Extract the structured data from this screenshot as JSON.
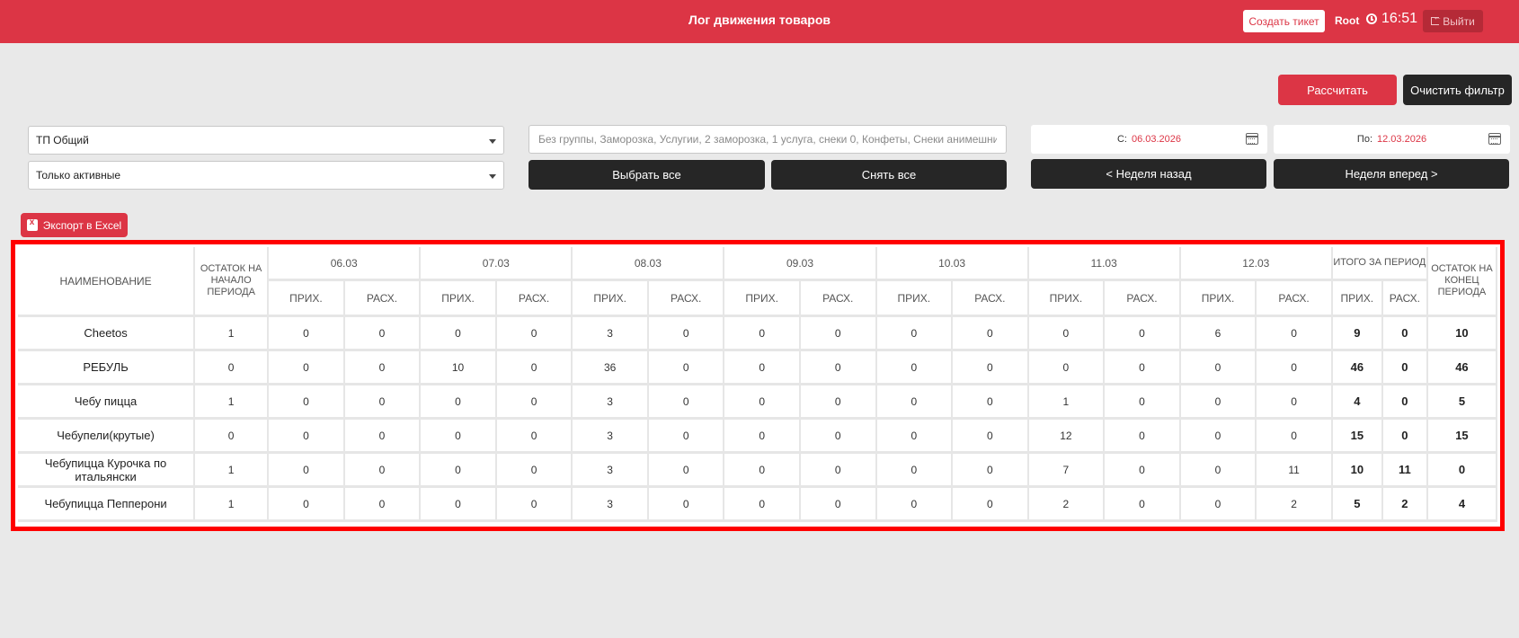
{
  "header": {
    "title": "Лог движения товаров",
    "create_ticket": "Создать тикет",
    "user": "Root",
    "time": "16:51",
    "logout": "Выйти"
  },
  "actions": {
    "calculate": "Рассчитать",
    "clear_filter": "Очистить фильтр"
  },
  "filters": {
    "point": "ТП Общий",
    "status": "Только активные",
    "groups_placeholder": "Без группы, Заморозка, Услугии, 2 заморозка, 1 услуга, снеки 0, Конфеты, Снеки анимешника,",
    "select_all": "Выбрать все",
    "unselect_all": "Снять все",
    "date_from_label": "С:",
    "date_from": "06.03.2026",
    "date_to_label": "По:",
    "date_to": "12.03.2026",
    "week_back": "< Неделя назад",
    "week_forward": "Неделя вперед >"
  },
  "export_label": "Экспорт в Excel",
  "table": {
    "col_name": "НАИМЕНОВАНИЕ",
    "col_start": "ОСТАТОК НА НАЧАЛО ПЕРИОДА",
    "col_total": "ИТОГО ЗА ПЕРИОД",
    "col_end": "ОСТАТОК НА КОНЕЦ ПЕРИОДА",
    "income": "ПРИХ.",
    "expense": "РАСХ.",
    "dates": [
      "06.03",
      "07.03",
      "08.03",
      "09.03",
      "10.03",
      "11.03",
      "12.03"
    ],
    "rows": [
      {
        "name": "Cheetos",
        "start": "1",
        "days": [
          [
            "0",
            "0"
          ],
          [
            "0",
            "0"
          ],
          [
            "3",
            "0"
          ],
          [
            "0",
            "0"
          ],
          [
            "0",
            "0"
          ],
          [
            "0",
            "0"
          ],
          [
            "6",
            "0"
          ]
        ],
        "in": "9",
        "out": "0",
        "end": "10"
      },
      {
        "name": "РЕБУЛЬ",
        "start": "0",
        "days": [
          [
            "0",
            "0"
          ],
          [
            "10",
            "0"
          ],
          [
            "36",
            "0"
          ],
          [
            "0",
            "0"
          ],
          [
            "0",
            "0"
          ],
          [
            "0",
            "0"
          ],
          [
            "0",
            "0"
          ]
        ],
        "in": "46",
        "out": "0",
        "end": "46"
      },
      {
        "name": "Чебу пицца",
        "start": "1",
        "days": [
          [
            "0",
            "0"
          ],
          [
            "0",
            "0"
          ],
          [
            "3",
            "0"
          ],
          [
            "0",
            "0"
          ],
          [
            "0",
            "0"
          ],
          [
            "1",
            "0"
          ],
          [
            "0",
            "0"
          ]
        ],
        "in": "4",
        "out": "0",
        "end": "5"
      },
      {
        "name": "Чебупели(крутые)",
        "start": "0",
        "days": [
          [
            "0",
            "0"
          ],
          [
            "0",
            "0"
          ],
          [
            "3",
            "0"
          ],
          [
            "0",
            "0"
          ],
          [
            "0",
            "0"
          ],
          [
            "12",
            "0"
          ],
          [
            "0",
            "0"
          ]
        ],
        "in": "15",
        "out": "0",
        "end": "15"
      },
      {
        "name": "Чебупицца Курочка по итальянски",
        "start": "1",
        "days": [
          [
            "0",
            "0"
          ],
          [
            "0",
            "0"
          ],
          [
            "3",
            "0"
          ],
          [
            "0",
            "0"
          ],
          [
            "0",
            "0"
          ],
          [
            "7",
            "0"
          ],
          [
            "0",
            "11"
          ]
        ],
        "in": "10",
        "out": "11",
        "end": "0"
      },
      {
        "name": "Чебупицца Пепперони",
        "start": "1",
        "days": [
          [
            "0",
            "0"
          ],
          [
            "0",
            "0"
          ],
          [
            "3",
            "0"
          ],
          [
            "0",
            "0"
          ],
          [
            "0",
            "0"
          ],
          [
            "2",
            "0"
          ],
          [
            "0",
            "2"
          ]
        ],
        "in": "5",
        "out": "2",
        "end": "4"
      }
    ]
  }
}
